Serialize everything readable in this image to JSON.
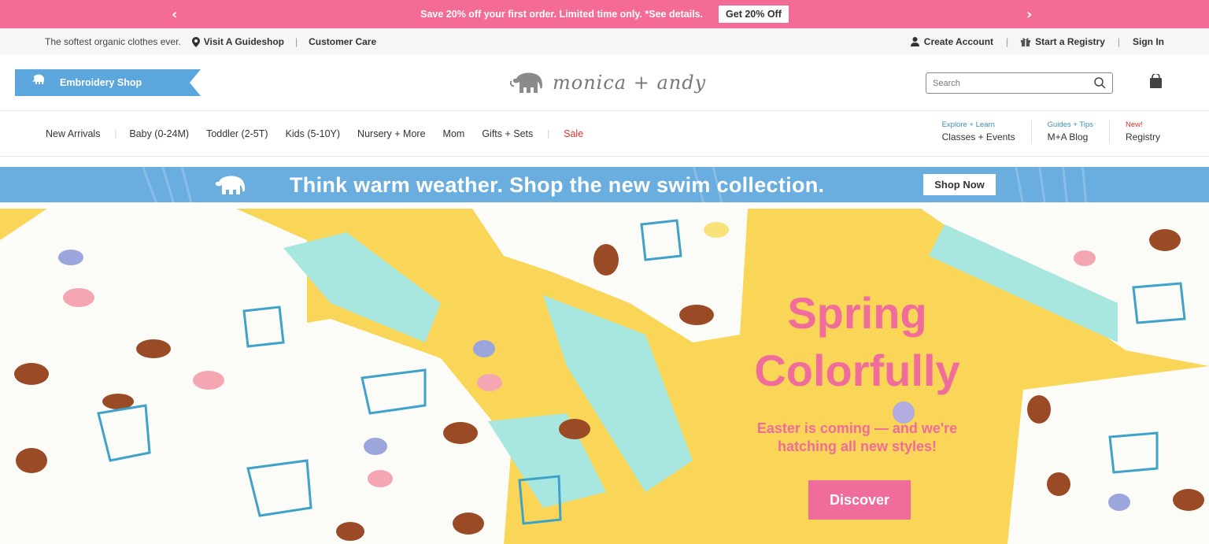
{
  "promo": {
    "message": "Save 20% off your first order. Limited time only. *See details.",
    "cta": "Get 20% Off",
    "bg_color": "#f46b96"
  },
  "utility": {
    "tagline": "The softest organic clothes ever.",
    "visit": "Visit A Guideshop",
    "care": "Customer Care",
    "create_account": "Create Account",
    "registry": "Start a Registry",
    "sign_in": "Sign In"
  },
  "header": {
    "embroidery": "Embroidery Shop",
    "logo": "monica + andy",
    "search_placeholder": "Search"
  },
  "nav": {
    "items": [
      "New Arrivals",
      "Baby (0-24M)",
      "Toddler (2-5T)",
      "Kids (5-10Y)",
      "Nursery + More",
      "Mom",
      "Gifts + Sets",
      "Sale"
    ],
    "right": [
      {
        "small": "Explore + Learn",
        "big": "Classes + Events"
      },
      {
        "small": "Guides + Tips",
        "big": "M+A Blog"
      },
      {
        "small": "New!",
        "big": "Registry"
      }
    ]
  },
  "swim_banner": {
    "text": "Think warm weather. Shop the new swim collection.",
    "cta": "Shop Now",
    "bg_color": "#6aaedf"
  },
  "hero": {
    "title_line1": "Spring",
    "title_line2": "Colorfully",
    "subtitle_line1": "Easter is coming — and we're",
    "subtitle_line2": "hatching all new styles!",
    "cta": "Discover",
    "accent_color": "#f06c9a",
    "bg_color": "#f9d657"
  }
}
